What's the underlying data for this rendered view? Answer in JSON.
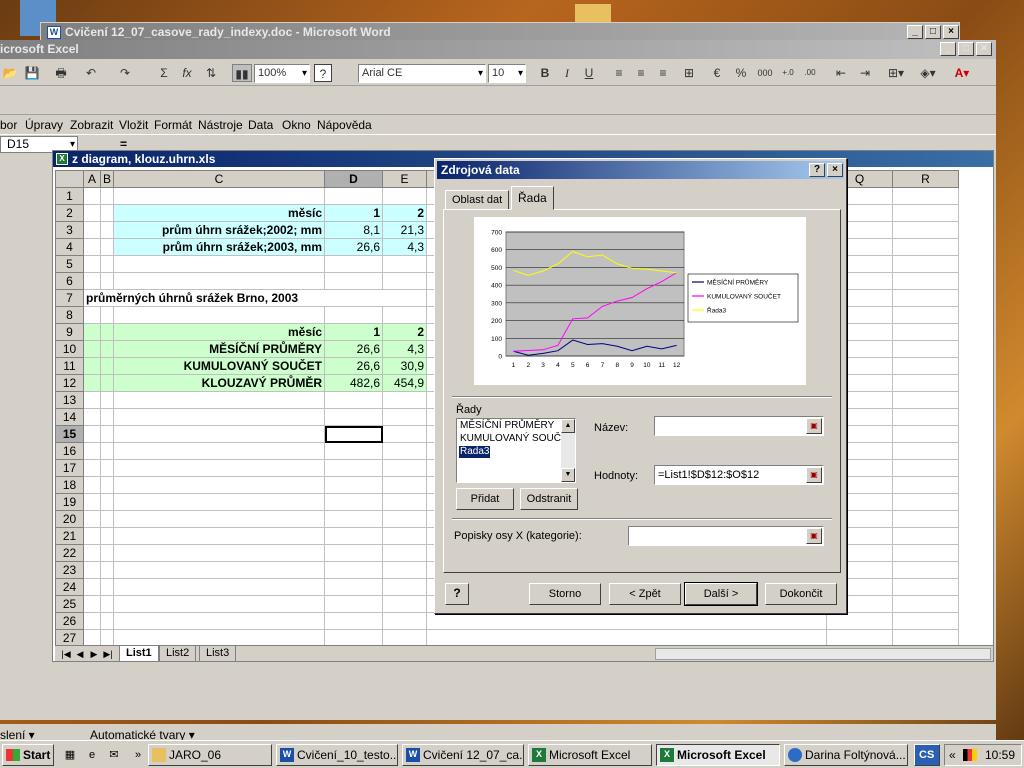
{
  "word_window": {
    "title": "Cvičení 12_07_casove_rady_indexy.doc - Microsoft Word",
    "icon": "W"
  },
  "excel_window": {
    "title": "icrosoft Excel"
  },
  "toolbar": {
    "zoom": "100%",
    "font_name": "Arial CE",
    "font_size": "10",
    "sum": "Σ",
    "fx": "fx",
    "bold": "B",
    "italic": "I",
    "underline": "U",
    "percent": "%",
    "thousands": "000"
  },
  "menu": [
    "bor",
    "Úpravy",
    "Zobrazit",
    "Vložit",
    "Formát",
    "Nástroje",
    "Data",
    "Okno",
    "Nápověda"
  ],
  "formula_bar": {
    "name_box": "D15",
    "equals": "="
  },
  "workbook": {
    "title": "z diagram, klouz.uhrn.xls",
    "columns": [
      "A",
      "B",
      "C",
      "D",
      "E"
    ],
    "right_columns": [
      "Q",
      "R"
    ],
    "rows": {
      "r2": {
        "label": "měsíc",
        "d": "1",
        "e": "2"
      },
      "r3": {
        "label": "prům úhrn srážek;2002; mm",
        "d": "8,1",
        "e": "21,3"
      },
      "r4": {
        "label": "prům úhrn srážek;2003, mm",
        "d": "26,6",
        "e": "4,3"
      },
      "r7": {
        "label": "průměrných úhrnů srážek Brno, 2003"
      },
      "r9": {
        "label": "měsíc",
        "d": "1",
        "e": "2"
      },
      "r10": {
        "label": "MĚSÍČNÍ PRŮMĚRY",
        "d": "26,6",
        "e": "4,3"
      },
      "r11": {
        "label": "KUMULOVANÝ SOUČET",
        "d": "26,6",
        "e": "30,9"
      },
      "r12": {
        "label": "KLOUZAVÝ PRŮMĚR",
        "d": "482,6",
        "e": "454,9"
      }
    },
    "row_numbers": [
      "1",
      "2",
      "3",
      "4",
      "5",
      "6",
      "7",
      "8",
      "9",
      "10",
      "11",
      "12",
      "13",
      "14",
      "15",
      "16",
      "17",
      "18",
      "19",
      "20",
      "21",
      "22",
      "23",
      "24",
      "25",
      "26",
      "27"
    ],
    "sheets": [
      "List1",
      "List2",
      "List3"
    ]
  },
  "dialog": {
    "title": "Zdrojová data",
    "help_q": "?",
    "close": "×",
    "tabs": [
      "Oblast dat",
      "Řada"
    ],
    "series_label": "Řady",
    "series_items": [
      "MĚSÍČNÍ PRŮMĚRY",
      "KUMULOVANÝ SOUČET",
      "Řada3"
    ],
    "name_label": "Název:",
    "name_value": "",
    "values_label": "Hodnoty:",
    "values_value": "=List1!$D$12:$O$12",
    "add_button": "Přidat",
    "remove_button": "Odstranit",
    "category_label": "Popisky osy X (kategorie):",
    "category_value": "",
    "buttons": {
      "cancel": "Storno",
      "back": "< Zpět",
      "next": "Další >",
      "finish": "Dokončit"
    }
  },
  "chart_data": {
    "type": "line",
    "categories": [
      "1",
      "2",
      "3",
      "4",
      "5",
      "6",
      "7",
      "8",
      "9",
      "10",
      "11",
      "12"
    ],
    "ylim": [
      0,
      700
    ],
    "yticks": [
      "0",
      "100",
      "200",
      "300",
      "400",
      "500",
      "600",
      "700"
    ],
    "grid": true,
    "legend_position": "right",
    "series": [
      {
        "name": "MĚSÍČNÍ PRŮMĚRY",
        "color": "#000080",
        "values": [
          27,
          4,
          15,
          30,
          90,
          65,
          70,
          55,
          30,
          55,
          40,
          60
        ]
      },
      {
        "name": "KUMULOVANÝ SOUČET",
        "color": "#ff00ff",
        "values": [
          27,
          31,
          35,
          60,
          210,
          215,
          280,
          310,
          330,
          380,
          420,
          470
        ]
      },
      {
        "name": "Řada3",
        "color": "#ffff00",
        "values": [
          483,
          455,
          480,
          520,
          590,
          560,
          570,
          520,
          495,
          490,
          480,
          470
        ]
      }
    ]
  },
  "excel_bottom": {
    "draw": "slení ▾",
    "autoshapes": "Automatické tvary ▾"
  },
  "taskbar": {
    "start": "Start",
    "tasks": [
      "JARO_06",
      "Cvičení_10_testo...",
      "Cvičení 12_07_ca...",
      "Microsoft Excel",
      "Microsoft Excel",
      "Darina Foltýnová..."
    ],
    "lang": "CS",
    "clock": "10:59"
  },
  "colors": {
    "title_active": "#0a246a",
    "cell_cyan": "#ccffff",
    "cell_green": "#ccffcc"
  }
}
